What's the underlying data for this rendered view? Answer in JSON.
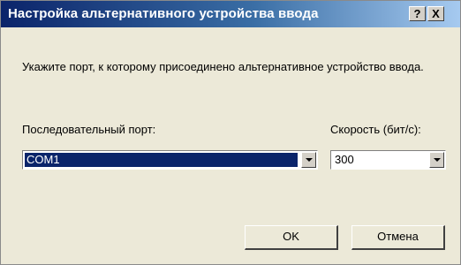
{
  "window": {
    "title": "Настройка альтернативного устройства ввода",
    "help_button": "?",
    "close_button": "X"
  },
  "instruction": "Укажите порт, к которому присоединено альтернативное устройство ввода.",
  "port": {
    "label": "Последовательный порт:",
    "selected": "COM1"
  },
  "speed": {
    "label": "Скорость (бит/с):",
    "selected": "300"
  },
  "buttons": {
    "ok": "OK",
    "cancel": "Отмена"
  }
}
